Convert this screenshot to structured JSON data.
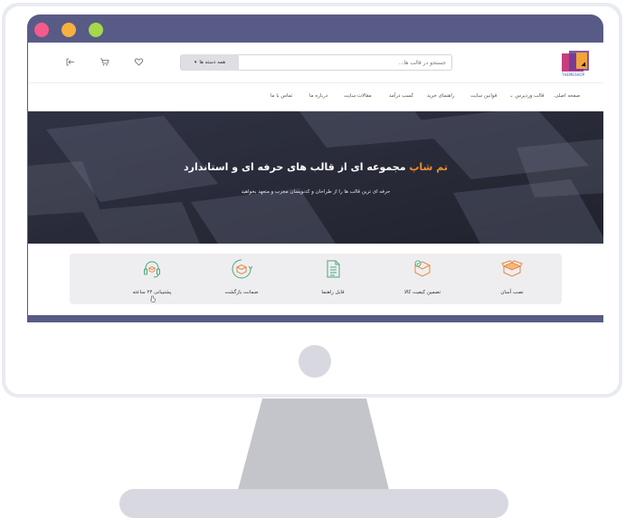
{
  "window": {
    "controls": [
      "close",
      "minimize",
      "maximize"
    ]
  },
  "logo": {
    "text": "THEMESHOP"
  },
  "search": {
    "placeholder": "جستجو در قالب ها...",
    "category_label": "همه دسته ها"
  },
  "header_icons": [
    "login-icon",
    "cart-icon",
    "heart-icon"
  ],
  "nav": {
    "items": [
      "صفحه اصلی",
      "قالب وردپرس",
      "قوانین سایت",
      "راهنمای خرید",
      "کسب درآمد",
      "مقالات سایت",
      "درباره ما",
      "تماس با ما"
    ]
  },
  "hero": {
    "title_accent": "تم شاپ",
    "title_rest": "مجموعه ای از قالب های حرفه ای و استاندارد",
    "subtitle": "حرفه ای ترین قالب ها را از طراحان و کدنویسان مجرب و متعهد بخواهید"
  },
  "features": [
    {
      "label": "نصب آسان",
      "icon": "box-open-icon"
    },
    {
      "label": "تضمین کیفیت کالا",
      "icon": "quality-box-icon"
    },
    {
      "label": "فایل راهنما",
      "icon": "document-icon"
    },
    {
      "label": "ضمانت بازگشت",
      "icon": "return-box-icon"
    },
    {
      "label": "پشتیبانی ۲۴ ساعته",
      "icon": "headset-icon"
    }
  ],
  "colors": {
    "accent": "#f28c2d",
    "icon_orange": "#e8873a",
    "icon_green": "#4aa87a",
    "bezel": "#585b85",
    "hero_bg": "#2f3144"
  }
}
